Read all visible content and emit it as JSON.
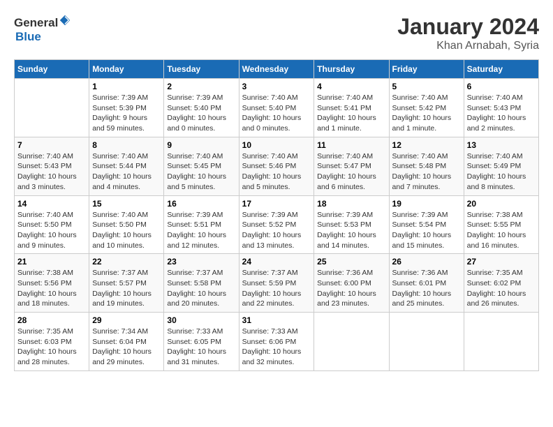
{
  "header": {
    "logo_general": "General",
    "logo_blue": "Blue",
    "month_title": "January 2024",
    "location": "Khan Arnabah, Syria"
  },
  "weekdays": [
    "Sunday",
    "Monday",
    "Tuesday",
    "Wednesday",
    "Thursday",
    "Friday",
    "Saturday"
  ],
  "weeks": [
    [
      {
        "day": "",
        "info": ""
      },
      {
        "day": "1",
        "info": "Sunrise: 7:39 AM\nSunset: 5:39 PM\nDaylight: 9 hours\nand 59 minutes."
      },
      {
        "day": "2",
        "info": "Sunrise: 7:39 AM\nSunset: 5:40 PM\nDaylight: 10 hours\nand 0 minutes."
      },
      {
        "day": "3",
        "info": "Sunrise: 7:40 AM\nSunset: 5:40 PM\nDaylight: 10 hours\nand 0 minutes."
      },
      {
        "day": "4",
        "info": "Sunrise: 7:40 AM\nSunset: 5:41 PM\nDaylight: 10 hours\nand 1 minute."
      },
      {
        "day": "5",
        "info": "Sunrise: 7:40 AM\nSunset: 5:42 PM\nDaylight: 10 hours\nand 1 minute."
      },
      {
        "day": "6",
        "info": "Sunrise: 7:40 AM\nSunset: 5:43 PM\nDaylight: 10 hours\nand 2 minutes."
      }
    ],
    [
      {
        "day": "7",
        "info": "Sunrise: 7:40 AM\nSunset: 5:43 PM\nDaylight: 10 hours\nand 3 minutes."
      },
      {
        "day": "8",
        "info": "Sunrise: 7:40 AM\nSunset: 5:44 PM\nDaylight: 10 hours\nand 4 minutes."
      },
      {
        "day": "9",
        "info": "Sunrise: 7:40 AM\nSunset: 5:45 PM\nDaylight: 10 hours\nand 5 minutes."
      },
      {
        "day": "10",
        "info": "Sunrise: 7:40 AM\nSunset: 5:46 PM\nDaylight: 10 hours\nand 5 minutes."
      },
      {
        "day": "11",
        "info": "Sunrise: 7:40 AM\nSunset: 5:47 PM\nDaylight: 10 hours\nand 6 minutes."
      },
      {
        "day": "12",
        "info": "Sunrise: 7:40 AM\nSunset: 5:48 PM\nDaylight: 10 hours\nand 7 minutes."
      },
      {
        "day": "13",
        "info": "Sunrise: 7:40 AM\nSunset: 5:49 PM\nDaylight: 10 hours\nand 8 minutes."
      }
    ],
    [
      {
        "day": "14",
        "info": "Sunrise: 7:40 AM\nSunset: 5:50 PM\nDaylight: 10 hours\nand 9 minutes."
      },
      {
        "day": "15",
        "info": "Sunrise: 7:40 AM\nSunset: 5:50 PM\nDaylight: 10 hours\nand 10 minutes."
      },
      {
        "day": "16",
        "info": "Sunrise: 7:39 AM\nSunset: 5:51 PM\nDaylight: 10 hours\nand 12 minutes."
      },
      {
        "day": "17",
        "info": "Sunrise: 7:39 AM\nSunset: 5:52 PM\nDaylight: 10 hours\nand 13 minutes."
      },
      {
        "day": "18",
        "info": "Sunrise: 7:39 AM\nSunset: 5:53 PM\nDaylight: 10 hours\nand 14 minutes."
      },
      {
        "day": "19",
        "info": "Sunrise: 7:39 AM\nSunset: 5:54 PM\nDaylight: 10 hours\nand 15 minutes."
      },
      {
        "day": "20",
        "info": "Sunrise: 7:38 AM\nSunset: 5:55 PM\nDaylight: 10 hours\nand 16 minutes."
      }
    ],
    [
      {
        "day": "21",
        "info": "Sunrise: 7:38 AM\nSunset: 5:56 PM\nDaylight: 10 hours\nand 18 minutes."
      },
      {
        "day": "22",
        "info": "Sunrise: 7:37 AM\nSunset: 5:57 PM\nDaylight: 10 hours\nand 19 minutes."
      },
      {
        "day": "23",
        "info": "Sunrise: 7:37 AM\nSunset: 5:58 PM\nDaylight: 10 hours\nand 20 minutes."
      },
      {
        "day": "24",
        "info": "Sunrise: 7:37 AM\nSunset: 5:59 PM\nDaylight: 10 hours\nand 22 minutes."
      },
      {
        "day": "25",
        "info": "Sunrise: 7:36 AM\nSunset: 6:00 PM\nDaylight: 10 hours\nand 23 minutes."
      },
      {
        "day": "26",
        "info": "Sunrise: 7:36 AM\nSunset: 6:01 PM\nDaylight: 10 hours\nand 25 minutes."
      },
      {
        "day": "27",
        "info": "Sunrise: 7:35 AM\nSunset: 6:02 PM\nDaylight: 10 hours\nand 26 minutes."
      }
    ],
    [
      {
        "day": "28",
        "info": "Sunrise: 7:35 AM\nSunset: 6:03 PM\nDaylight: 10 hours\nand 28 minutes."
      },
      {
        "day": "29",
        "info": "Sunrise: 7:34 AM\nSunset: 6:04 PM\nDaylight: 10 hours\nand 29 minutes."
      },
      {
        "day": "30",
        "info": "Sunrise: 7:33 AM\nSunset: 6:05 PM\nDaylight: 10 hours\nand 31 minutes."
      },
      {
        "day": "31",
        "info": "Sunrise: 7:33 AM\nSunset: 6:06 PM\nDaylight: 10 hours\nand 32 minutes."
      },
      {
        "day": "",
        "info": ""
      },
      {
        "day": "",
        "info": ""
      },
      {
        "day": "",
        "info": ""
      }
    ]
  ]
}
